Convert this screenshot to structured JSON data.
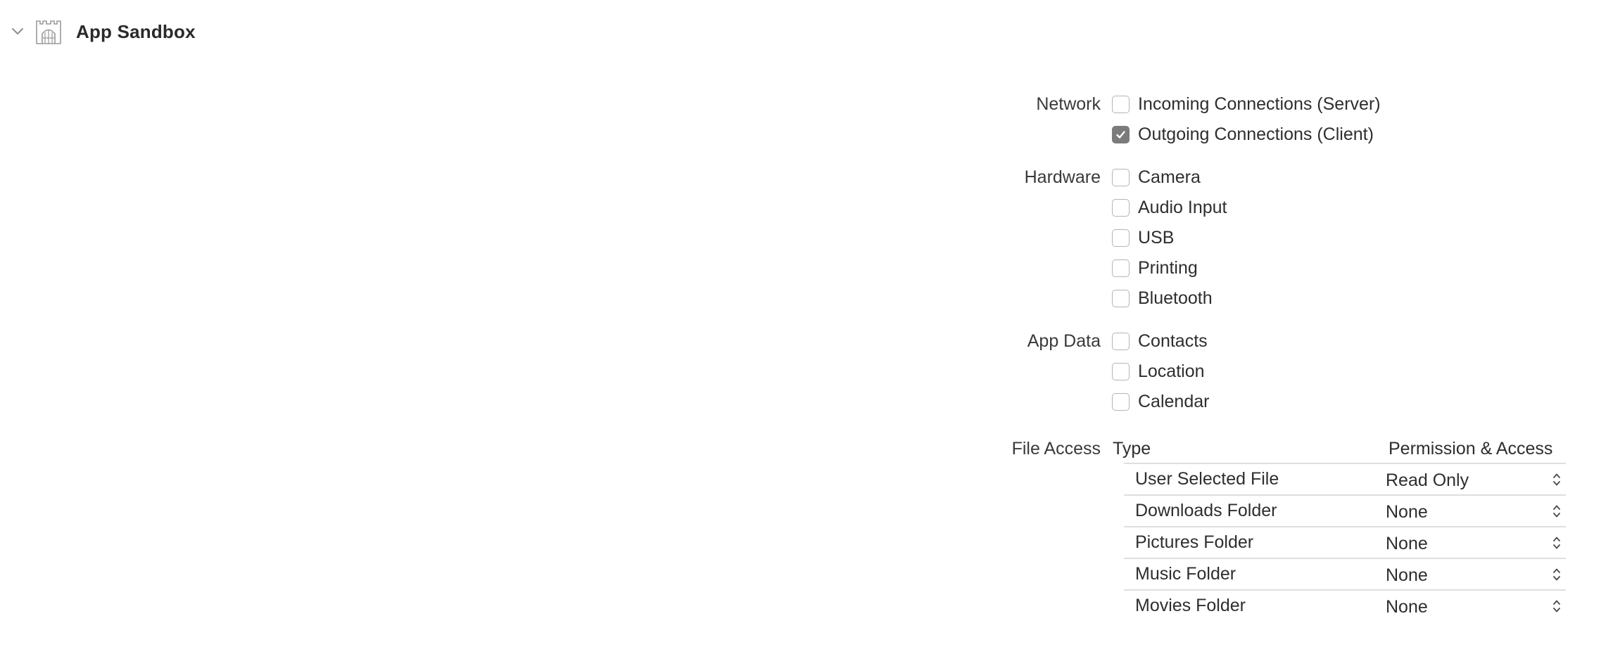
{
  "header": {
    "title": "App Sandbox",
    "icons": {
      "disclosure": "chevron-down-icon",
      "capability": "sandbox-icon"
    }
  },
  "sections": {
    "network": {
      "label": "Network",
      "options": [
        {
          "label": "Incoming Connections (Server)",
          "checked": false
        },
        {
          "label": "Outgoing Connections (Client)",
          "checked": true
        }
      ]
    },
    "hardware": {
      "label": "Hardware",
      "options": [
        {
          "label": "Camera",
          "checked": false
        },
        {
          "label": "Audio Input",
          "checked": false
        },
        {
          "label": "USB",
          "checked": false
        },
        {
          "label": "Printing",
          "checked": false
        },
        {
          "label": "Bluetooth",
          "checked": false
        }
      ]
    },
    "app_data": {
      "label": "App Data",
      "options": [
        {
          "label": "Contacts",
          "checked": false
        },
        {
          "label": "Location",
          "checked": false
        },
        {
          "label": "Calendar",
          "checked": false
        }
      ]
    },
    "file_access": {
      "label": "File Access",
      "columns": {
        "type": "Type",
        "permission": "Permission & Access"
      },
      "rows": [
        {
          "type": "User Selected File",
          "permission": "Read Only"
        },
        {
          "type": "Downloads Folder",
          "permission": "None"
        },
        {
          "type": "Pictures Folder",
          "permission": "None"
        },
        {
          "type": "Music Folder",
          "permission": "None"
        },
        {
          "type": "Movies Folder",
          "permission": "None"
        }
      ]
    }
  },
  "colors": {
    "checkbox_checked": "#7b7b7b",
    "checkbox_border": "#b4b4b4",
    "row_rule": "#dedede"
  }
}
